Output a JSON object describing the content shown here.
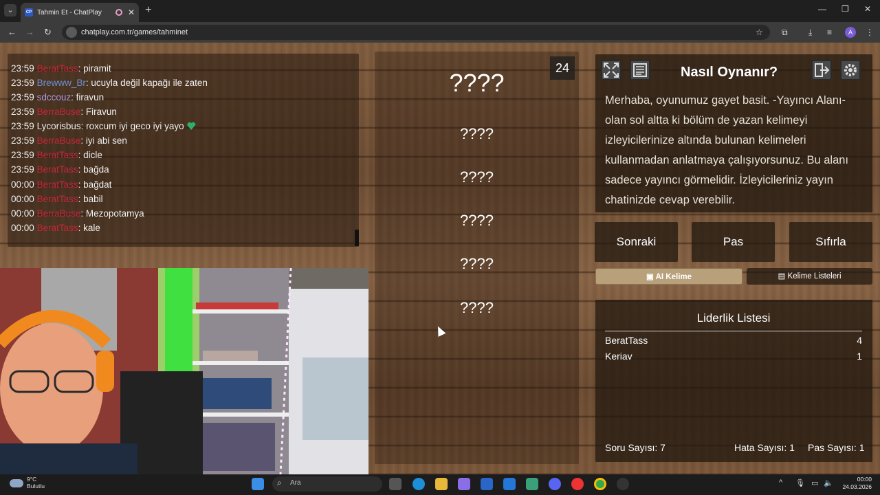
{
  "browser": {
    "tab_title": "Tahmin Et - ChatPlay",
    "tab_favicon": "CP",
    "url": "chatplay.com.tr/games/tahminet",
    "profile_initial": "A"
  },
  "chat": {
    "messages": [
      {
        "time": "23:59",
        "user": "BeratTass",
        "text": ": piramit"
      },
      {
        "time": "23:59",
        "user": "Brewww_Br",
        "text": ": ucuyla değil kapağı ile zaten"
      },
      {
        "time": "23:59",
        "user": "sdccouz",
        "text": ": firavun"
      },
      {
        "time": "23:59",
        "user": "BerraBuse",
        "text": ": Firavun"
      },
      {
        "time": "23:59",
        "user": "Lycorisbus",
        "text": ": roxcum iyi geco iyi yayo"
      },
      {
        "time": "23:59",
        "user": "BerraBuse",
        "text": ": iyi abi sen"
      },
      {
        "time": "23:59",
        "user": "BeratTass",
        "text": ": dicle"
      },
      {
        "time": "23:59",
        "user": "BeratTass",
        "text": ": bağda"
      },
      {
        "time": "00:00",
        "user": "BeratTass",
        "text": ": bağdat"
      },
      {
        "time": "00:00",
        "user": "BeratTass",
        "text": ": babil"
      },
      {
        "time": "00:00",
        "user": "BerraBuse",
        "text": ": Mezopotamya"
      },
      {
        "time": "00:00",
        "user": "BeratTass",
        "text": ": kale"
      }
    ]
  },
  "game": {
    "timer": "24",
    "words": [
      "????",
      "????",
      "????",
      "????",
      "????",
      "????"
    ]
  },
  "howto": {
    "title": "Nasıl Oynanır?",
    "text": "Merhaba, oyunumuz gayet basit. -Yayıncı Alanı- olan sol altta ki bölüm de yazan kelimeyi izleyicilerinize altında bulunan kelimeleri kullanmadan anlatmaya çalışıyorsunuz. Bu alanı sadece yayıncı görmelidir. İzleyicileriniz yayın chatinizde cevap verebilir."
  },
  "buttons": {
    "next": "Sonraki",
    "pass": "Pas",
    "reset": "Sıfırla",
    "ai_word": "AI Kelime",
    "word_lists": "Kelime Listeleri"
  },
  "leaderboard": {
    "title": "Liderlik Listesi",
    "rows": [
      {
        "name": "BeratTass",
        "score": "4"
      },
      {
        "name": "Keriav",
        "score": "1"
      }
    ],
    "question_count": "Soru Sayısı: 7",
    "error_count": "Hata Sayısı: 1",
    "pass_count": "Pas Sayısı: 1"
  },
  "taskbar": {
    "weather_temp": "9°C",
    "weather_desc": "Bulutlu",
    "search_placeholder": "Ara",
    "time": "00:00",
    "date": "24.03.2026"
  },
  "colors": {
    "chat_red_user": "#c4263a",
    "chat_blue_user": "#6f8fd4",
    "ai_button": "#b8a07b"
  }
}
